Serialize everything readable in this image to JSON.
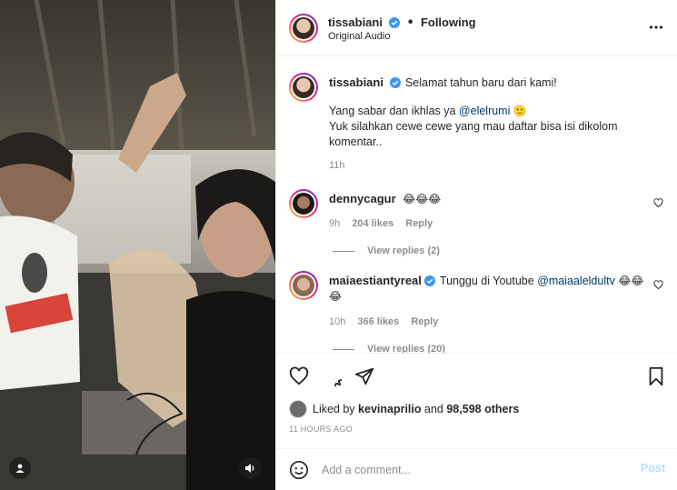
{
  "post": {
    "author": "tissabiani",
    "follow_status": "Following",
    "separator": "•",
    "audio": "Original Audio"
  },
  "caption": {
    "author": "tissabiani",
    "line1": "Selamat tahun baru dari kami!",
    "line2_prefix": "Yang sabar dan ikhlas ya ",
    "line2_mention": "@elelrumi",
    "line2_emoji": "🙂",
    "line3": "Yuk silahkan cewe cewe yang mau daftar bisa isi dikolom",
    "line4": "komentar..",
    "time": "11h"
  },
  "comments": [
    {
      "user": "dennycagur",
      "text": "😂😂😂",
      "time": "9h",
      "likes": "204 likes",
      "reply": "Reply",
      "view_replies": "View replies (2)"
    },
    {
      "user": "maiaestiantyreal",
      "text_prefix": "Tunggu di Youtube ",
      "mention": "@maiaaleldultv",
      "emoji_line1": "😂😂",
      "emoji_line2": "😂",
      "time": "10h",
      "likes": "366 likes",
      "reply": "Reply",
      "view_replies": "View replies (20)"
    }
  ],
  "likes": {
    "prefix": "Liked by ",
    "user": "kevinaprilio",
    "and": " and ",
    "others": "98,598 others"
  },
  "time_ago": "11 HOURS AGO",
  "add_comment": {
    "placeholder": "Add a comment...",
    "post_label": "Post"
  },
  "colors": {
    "verified": "#3897f0",
    "mention": "#00376b",
    "post_disabled": "#b2dffc"
  },
  "icons": [
    "user-icon",
    "sound-icon",
    "more-options-icon",
    "heart-icon",
    "comment-icon",
    "share-icon",
    "bookmark-icon",
    "emoji-icon",
    "verified-icon"
  ]
}
